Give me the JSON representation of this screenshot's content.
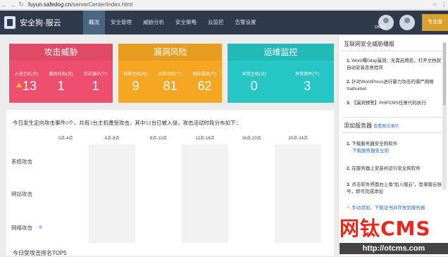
{
  "browser": {
    "url_host": "fuyun.safedog.cn",
    "url_path": "/serverCenter/index.html"
  },
  "header": {
    "brand": "安全狗·服云",
    "nav": [
      "概况",
      "安全管理",
      "威胁分析",
      "安全策略",
      "云监控",
      "告警设置"
    ],
    "active_index": 0,
    "demo_label": "DEMO",
    "pro_label": "专业版"
  },
  "cards": [
    {
      "title": "攻击威胁",
      "color": "#ef4f6e",
      "items": [
        {
          "label": "入侵主机(台)",
          "value": "13",
          "warn": true
        },
        {
          "label": "篡改攻击(次)",
          "value": "1"
        },
        {
          "label": "攻击源IP(个)",
          "value": "1"
        }
      ]
    },
    {
      "title": "漏洞风险",
      "color": "#f5a623",
      "items": [
        {
          "label": "风险主机(台)",
          "value": "9"
        },
        {
          "label": "风险项目(个)",
          "value": "81"
        },
        {
          "label": "网站漏洞(个)",
          "value": "62"
        }
      ]
    },
    {
      "title": "运维监控",
      "color": "#25c6c3",
      "items": [
        {
          "label": "异常主机(台)",
          "value": "0"
        },
        {
          "label": "异常事件(个)",
          "value": "3"
        }
      ]
    }
  ],
  "summary": {
    "p1": "今日发生定向攻击事件",
    "n1": "0",
    "p2": "个，共有",
    "n2": "1",
    "p3": "台主机遭受攻击，其中",
    "n3": "13",
    "p4": "台已被入侵，攻击活动时段分布如下："
  },
  "timeline": {
    "ticks": [
      "0点-4点",
      "4点-8点",
      "8点-12点",
      "12点-16点",
      "16点-20点",
      "20点-24点"
    ],
    "rows": [
      "系统攻击",
      "网站攻击",
      "网络攻击"
    ],
    "dot_color": "#b9c2f0"
  },
  "bottom_section": "今日受攻击排名TOP5",
  "right": {
    "threat_title": "互联网安全威胁播报",
    "threats": [
      {
        "num": "1.",
        "text": "Word曝0day漏洞：无需启用宏，打开文档就自动安装恶意程序"
      },
      {
        "num": "2.",
        "text": "针对WordPress进行暴力攻击的僵尸网络Sathurbot"
      },
      {
        "num": "3.",
        "text": "【漏洞预警】PHPCMS任意代码执行"
      }
    ],
    "add_title": "添加服务器",
    "add_link": "查看图文演示",
    "steps": [
      {
        "num": "1.",
        "text": "下载服务器安全狗软件",
        "link": "下载服务器安全狗"
      },
      {
        "num": "2.",
        "text": "在服务器上安装并运行安全狗软件"
      },
      {
        "num": "3.",
        "text": "点击软件界面右上角“加入服云”，登录服云账号，即可完成添加"
      }
    ],
    "tip": "手动添加，下载证书并存放到服务器"
  },
  "watermark": {
    "text": "网钛CMS",
    "url": "http://otcms.com"
  }
}
